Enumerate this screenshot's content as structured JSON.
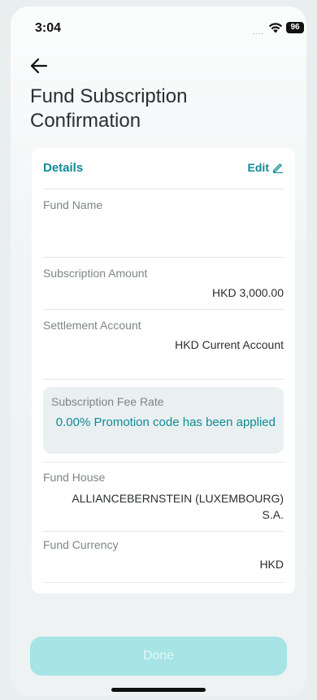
{
  "status_bar": {
    "time": "3:04",
    "signal": "....",
    "battery": "96"
  },
  "header": {
    "title_line1": "Fund Subscription",
    "title_line2": "Confirmation"
  },
  "details": {
    "title": "Details",
    "edit_label": "Edit",
    "fund_name": {
      "label": "Fund Name",
      "value": ""
    },
    "subscription_amount": {
      "label": "Subscription Amount",
      "value": "HKD 3,000.00"
    },
    "settlement_account": {
      "label": "Settlement Account",
      "value": "HKD Current Account"
    },
    "subscription_fee_rate": {
      "label": "Subscription Fee Rate",
      "value": "0.00% Promotion code has been applied"
    },
    "fund_house": {
      "label": "Fund House",
      "value_line1": "ALLIANCEBERNSTEIN (LUXEMBOURG)",
      "value_line2": "S.A."
    },
    "fund_currency": {
      "label": "Fund Currency",
      "value": "HKD"
    }
  },
  "footer": {
    "done_label": "Done"
  },
  "colors": {
    "accent": "#108a97",
    "done_button": "#a6e4e6",
    "fee_box": "#eaf0f1"
  }
}
